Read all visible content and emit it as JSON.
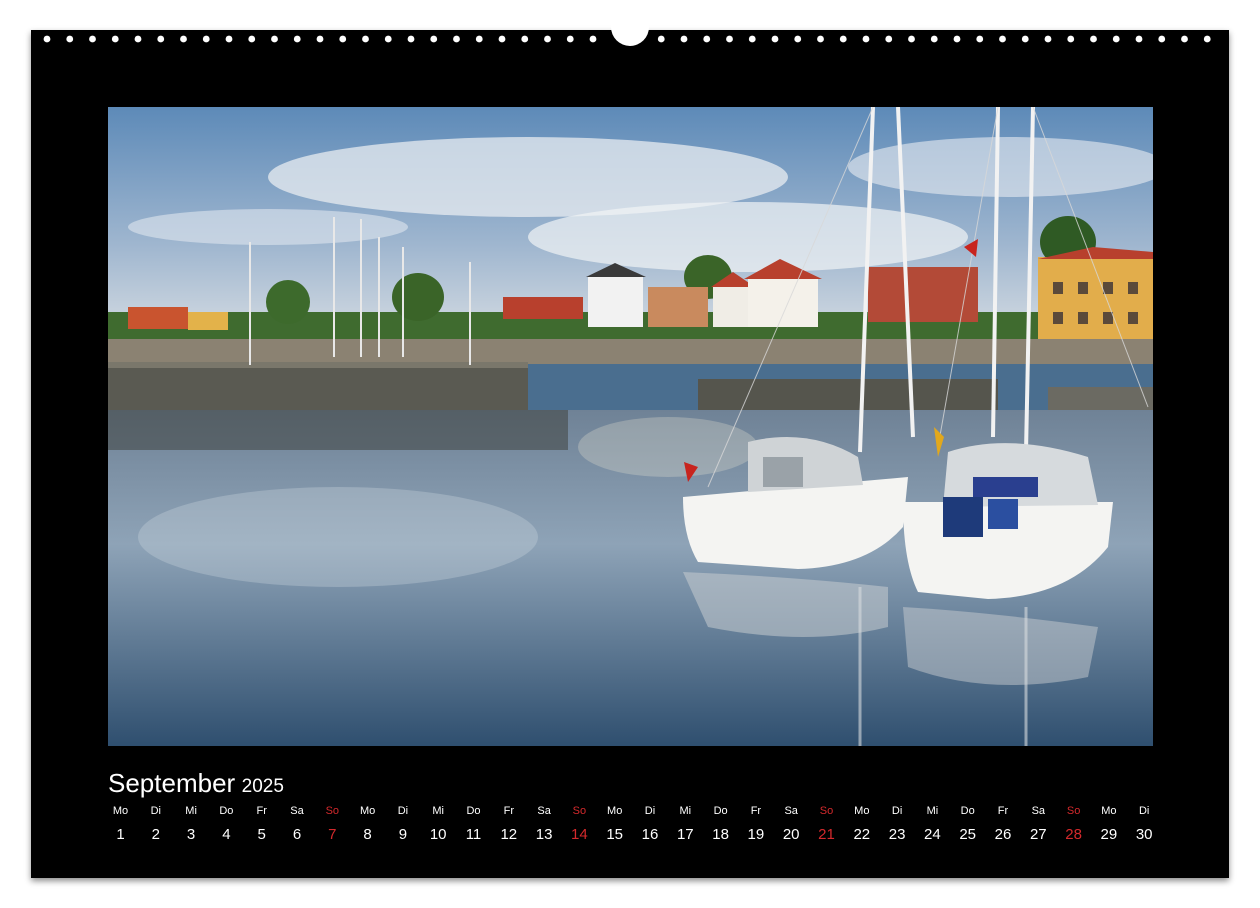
{
  "calendar": {
    "month": "September",
    "year": "2025",
    "days": [
      {
        "dow": "Mo",
        "num": "1",
        "sunday": false
      },
      {
        "dow": "Di",
        "num": "2",
        "sunday": false
      },
      {
        "dow": "Mi",
        "num": "3",
        "sunday": false
      },
      {
        "dow": "Do",
        "num": "4",
        "sunday": false
      },
      {
        "dow": "Fr",
        "num": "5",
        "sunday": false
      },
      {
        "dow": "Sa",
        "num": "6",
        "sunday": false
      },
      {
        "dow": "So",
        "num": "7",
        "sunday": true
      },
      {
        "dow": "Mo",
        "num": "8",
        "sunday": false
      },
      {
        "dow": "Di",
        "num": "9",
        "sunday": false
      },
      {
        "dow": "Mi",
        "num": "10",
        "sunday": false
      },
      {
        "dow": "Do",
        "num": "11",
        "sunday": false
      },
      {
        "dow": "Fr",
        "num": "12",
        "sunday": false
      },
      {
        "dow": "Sa",
        "num": "13",
        "sunday": false
      },
      {
        "dow": "So",
        "num": "14",
        "sunday": true
      },
      {
        "dow": "Mo",
        "num": "15",
        "sunday": false
      },
      {
        "dow": "Di",
        "num": "16",
        "sunday": false
      },
      {
        "dow": "Mi",
        "num": "17",
        "sunday": false
      },
      {
        "dow": "Do",
        "num": "18",
        "sunday": false
      },
      {
        "dow": "Fr",
        "num": "19",
        "sunday": false
      },
      {
        "dow": "Sa",
        "num": "20",
        "sunday": false
      },
      {
        "dow": "So",
        "num": "21",
        "sunday": true
      },
      {
        "dow": "Mo",
        "num": "22",
        "sunday": false
      },
      {
        "dow": "Di",
        "num": "23",
        "sunday": false
      },
      {
        "dow": "Mi",
        "num": "24",
        "sunday": false
      },
      {
        "dow": "Do",
        "num": "25",
        "sunday": false
      },
      {
        "dow": "Fr",
        "num": "26",
        "sunday": false
      },
      {
        "dow": "Sa",
        "num": "27",
        "sunday": false
      },
      {
        "dow": "So",
        "num": "28",
        "sunday": true
      },
      {
        "dow": "Mo",
        "num": "29",
        "sunday": false
      },
      {
        "dow": "Di",
        "num": "30",
        "sunday": false
      }
    ]
  },
  "colors": {
    "background": "#000000",
    "text": "#ffffff",
    "sunday": "#d3292c"
  },
  "icons": [
    "wire-binding-hole-icon",
    "calendar-hanger-icon"
  ]
}
